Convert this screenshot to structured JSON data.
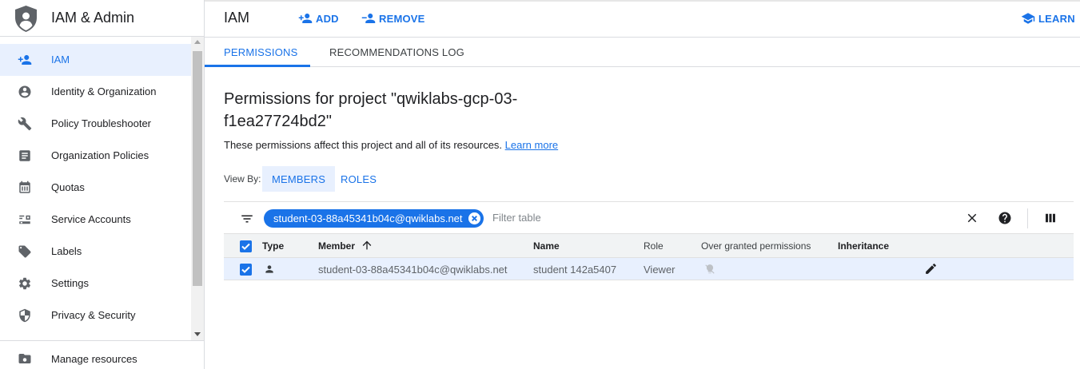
{
  "sidebar": {
    "title": "IAM & Admin",
    "items": [
      {
        "label": "IAM",
        "icon": "person-add-icon"
      },
      {
        "label": "Identity & Organization",
        "icon": "account-circle-icon"
      },
      {
        "label": "Policy Troubleshooter",
        "icon": "wrench-icon"
      },
      {
        "label": "Organization Policies",
        "icon": "document-icon"
      },
      {
        "label": "Quotas",
        "icon": "calendar-icon"
      },
      {
        "label": "Service Accounts",
        "icon": "service-account-icon"
      },
      {
        "label": "Labels",
        "icon": "label-icon"
      },
      {
        "label": "Settings",
        "icon": "gear-icon"
      },
      {
        "label": "Privacy & Security",
        "icon": "shield-icon"
      }
    ],
    "bottom_item": {
      "label": "Manage resources",
      "icon": "folder-settings-icon"
    }
  },
  "header": {
    "title": "IAM",
    "add_label": "ADD",
    "remove_label": "REMOVE",
    "learn_label": "LEARN"
  },
  "tabs": [
    {
      "label": "PERMISSIONS",
      "active": true
    },
    {
      "label": "RECOMMENDATIONS LOG",
      "active": false
    }
  ],
  "main": {
    "title": "Permissions for project \"qwiklabs-gcp-03-f1ea27724bd2\"",
    "description": "These permissions affect this project and all of its resources.",
    "learn_more": "Learn more",
    "view_by_label": "View By:",
    "view_by_members": "MEMBERS",
    "view_by_roles": "ROLES"
  },
  "filter": {
    "chip": "student-03-88a45341b04c@qwiklabs.net",
    "placeholder": "Filter table"
  },
  "table": {
    "headers": {
      "type": "Type",
      "member": "Member",
      "name": "Name",
      "role": "Role",
      "over_granted": "Over granted permissions",
      "inheritance": "Inheritance"
    },
    "rows": [
      {
        "member": "student-03-88a45341b04c@qwiklabs.net",
        "name": "student 142a5407",
        "role": "Viewer",
        "checked": true
      }
    ]
  },
  "colors": {
    "accent": "#1a73e8",
    "active_bg": "#e8f0fe",
    "header_bg": "#f1f3f4"
  }
}
